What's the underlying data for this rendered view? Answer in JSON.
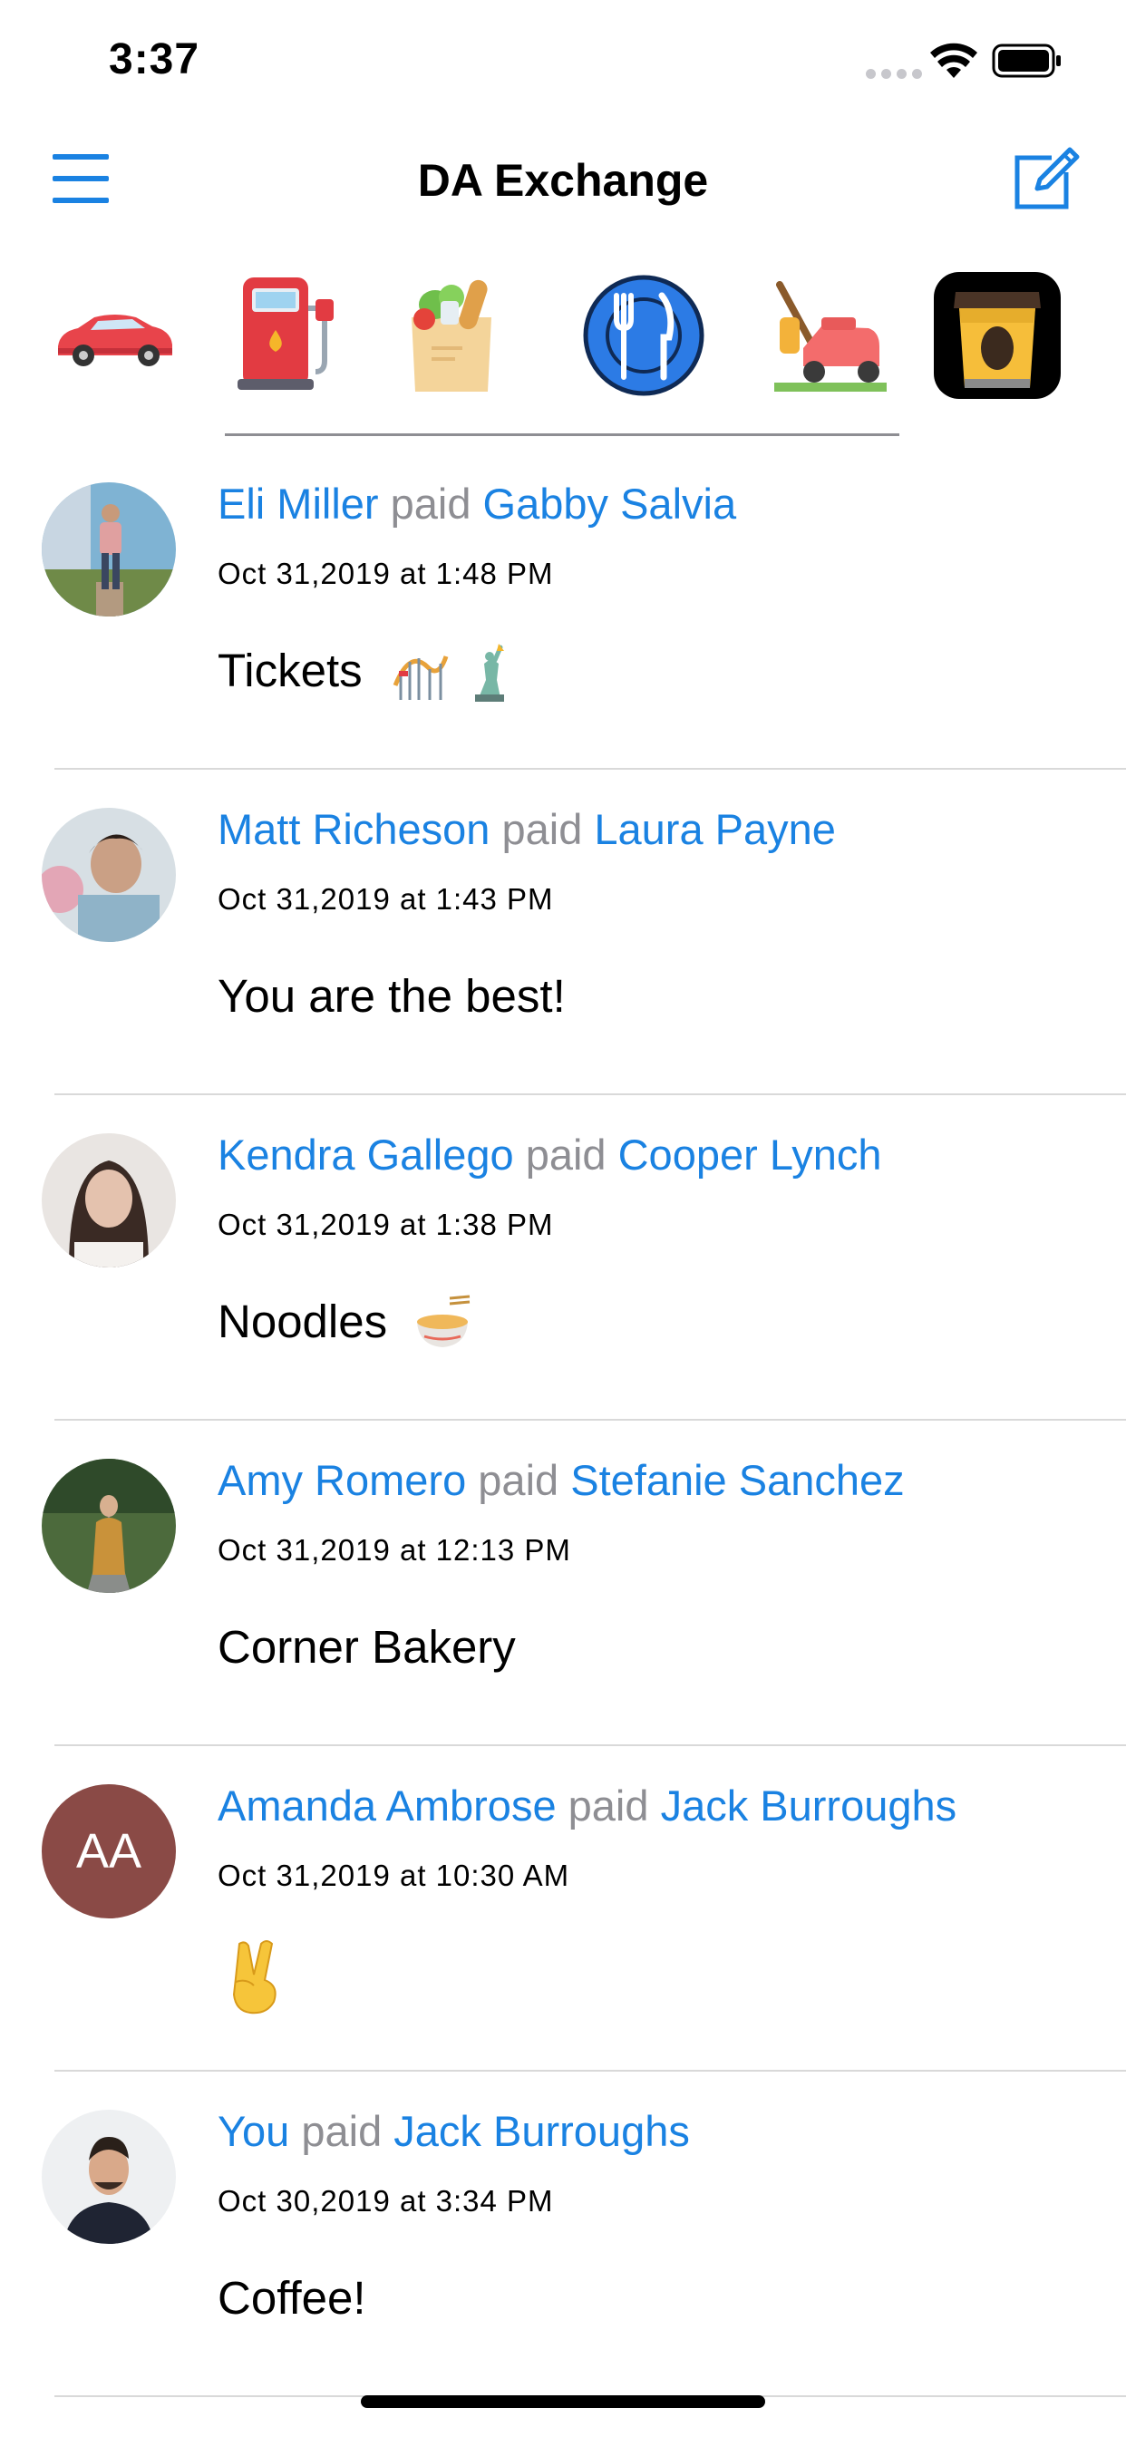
{
  "status_bar": {
    "time": "3:37"
  },
  "nav": {
    "title": "DA Exchange"
  },
  "categories": [
    {
      "icon": "sports-car-icon"
    },
    {
      "icon": "gas-pump-icon"
    },
    {
      "icon": "groceries-icon"
    },
    {
      "icon": "fork-knife-plate-icon"
    },
    {
      "icon": "lawn-mower-icon"
    },
    {
      "icon": "coffee-cup-icon"
    }
  ],
  "paid_label": "paid",
  "transactions": [
    {
      "payer": "Eli Miller",
      "payee": "Gabby Salvia",
      "timestamp": "Oct 31,2019 at 1:48 PM",
      "note": "Tickets",
      "note_emoji": [
        "roller-coaster-icon",
        "statue-of-liberty-icon"
      ]
    },
    {
      "payer": "Matt Richeson",
      "payee": "Laura Payne",
      "timestamp": "Oct 31,2019 at 1:43 PM",
      "note": "You are the best!",
      "note_emoji": []
    },
    {
      "payer": "Kendra Gallego",
      "payee": "Cooper Lynch",
      "timestamp": "Oct 31,2019 at 1:38 PM",
      "note": "Noodles",
      "note_emoji": [
        "noodle-bowl-icon"
      ]
    },
    {
      "payer": "Amy Romero",
      "payee": "Stefanie Sanchez",
      "timestamp": "Oct 31,2019 at 12:13 PM",
      "note": "Corner Bakery",
      "note_emoji": []
    },
    {
      "payer": "Amanda Ambrose",
      "payee": "Jack Burroughs",
      "timestamp": "Oct 31,2019 at 10:30 AM",
      "note": "",
      "avatar_initials": "AA",
      "note_emoji": [
        "victory-hand-icon"
      ]
    },
    {
      "payer": "You",
      "payee": "Jack Burroughs",
      "timestamp": "Oct 30,2019 at 3:34 PM",
      "note": "Coffee!",
      "note_emoji": []
    }
  ],
  "colors": {
    "link": "#1a82e2",
    "muted": "#8e8e93",
    "divider": "#d9d9d9"
  }
}
